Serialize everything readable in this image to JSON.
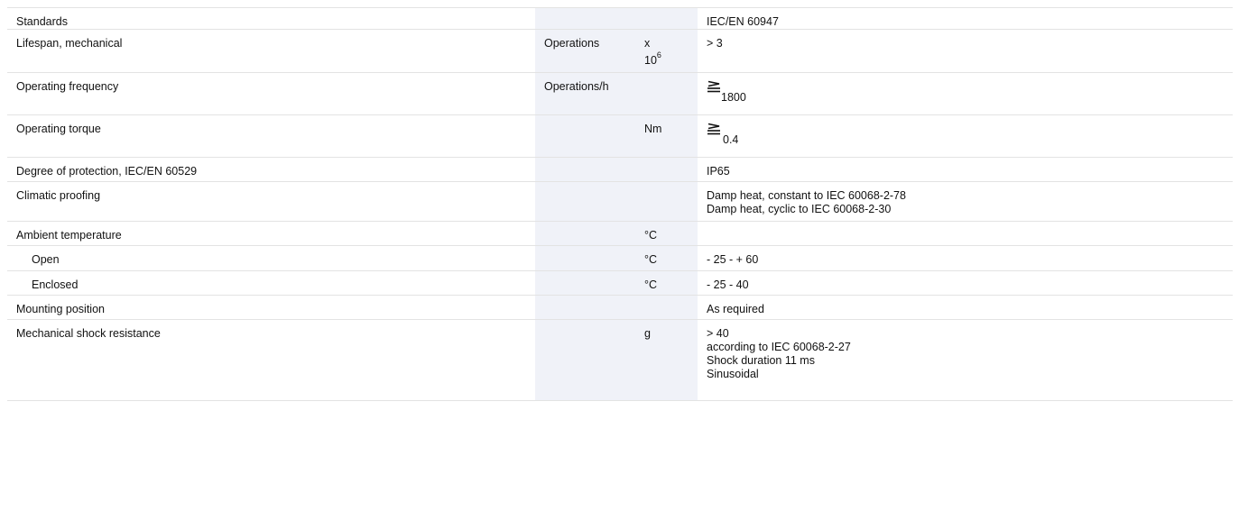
{
  "rows": [
    {
      "label": "Standards",
      "unit": "",
      "mult": "",
      "value": "IEC/EN 60947"
    },
    {
      "label": "Lifespan, mechanical",
      "unit": "Operations",
      "mult_base": "x",
      "mult_pow_base": "10",
      "mult_pow_exp": "6",
      "value": "> 3"
    },
    {
      "label": "Operating frequency",
      "unit": "Operations/h",
      "mult": "",
      "value_symbol": "less-or-equal-icon",
      "value_sub": "1800"
    },
    {
      "label": "Operating torque",
      "unit": "",
      "mult": "Nm",
      "value_symbol": "less-or-equal-icon",
      "value_sub": "0.4"
    },
    {
      "label": "Degree of protection, IEC/EN 60529",
      "unit": "",
      "mult": "",
      "value": "IP65"
    },
    {
      "label": "Climatic proofing",
      "unit": "",
      "mult": "",
      "value_lines": [
        "Damp heat, constant to IEC 60068-2-78",
        "Damp heat, cyclic to IEC 60068-2-30"
      ]
    },
    {
      "label": "Ambient temperature",
      "unit": "",
      "mult": "°C",
      "value": ""
    },
    {
      "label": "Open",
      "unit": "",
      "mult": "°C",
      "value": "- 25 - + 60"
    },
    {
      "label": "Enclosed",
      "unit": "",
      "mult": "°C",
      "value": "- 25 - 40"
    },
    {
      "label": "Mounting position",
      "unit": "",
      "mult": "",
      "value": "As required"
    },
    {
      "label": "Mechanical shock resistance",
      "unit": "",
      "mult": "g",
      "value_lines": [
        "> 40",
        "according to IEC 60068-2-27",
        "Shock duration 11 ms",
        "Sinusoidal"
      ]
    }
  ]
}
